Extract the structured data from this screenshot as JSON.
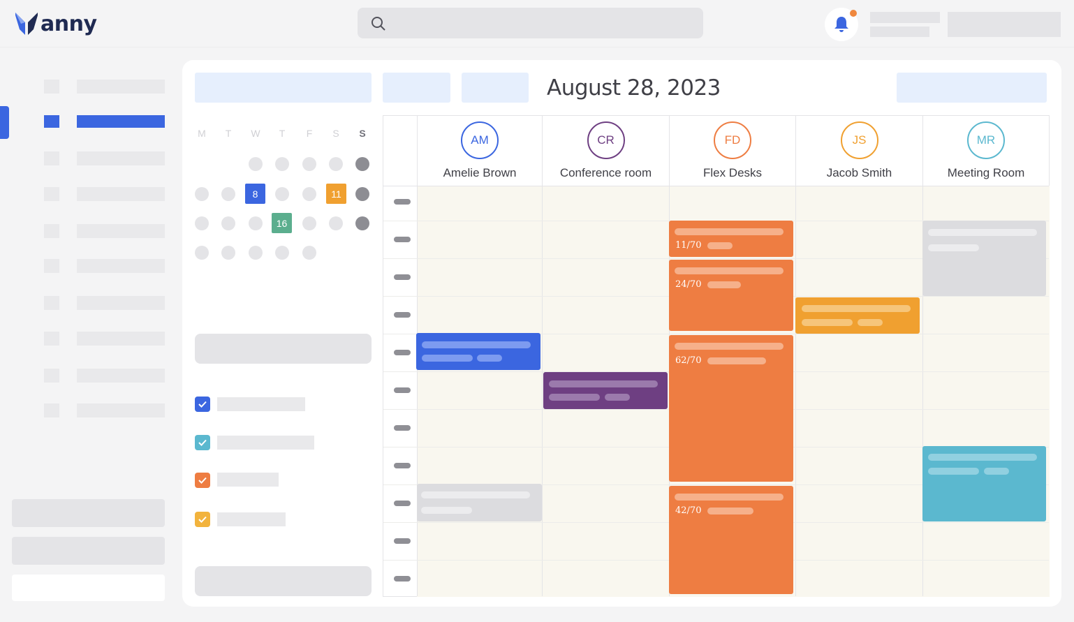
{
  "app": {
    "logo_text": "anny",
    "search_icon": "search-icon",
    "bell_icon": "bell-icon",
    "notification_dot_color": "#f0883e"
  },
  "calendar": {
    "title": "August 28, 2023",
    "weekdays": [
      "M",
      "T",
      "W",
      "T",
      "F",
      "S",
      "S"
    ],
    "highlighted_days": [
      {
        "day": "8",
        "color": "#3b66e0"
      },
      {
        "day": "11",
        "color": "#f0a030"
      },
      {
        "day": "16",
        "color": "#5bae8e"
      }
    ]
  },
  "filters": [
    {
      "color": "#3b66e0",
      "checked": true
    },
    {
      "color": "#5bb8cf",
      "checked": true
    },
    {
      "color": "#ee7d42",
      "checked": true
    },
    {
      "color": "#f2b33d",
      "checked": true
    }
  ],
  "resources": [
    {
      "initials": "AM",
      "name": "Amelie Brown",
      "color": "#3b66e0"
    },
    {
      "initials": "CR",
      "name": "Conference room",
      "color": "#6e3f82"
    },
    {
      "initials": "FD",
      "name": "Flex Desks",
      "color": "#ee7d42"
    },
    {
      "initials": "JS",
      "name": "Jacob Smith",
      "color": "#f0a030"
    },
    {
      "initials": "MR",
      "name": "Meeting Room",
      "color": "#5bb8cf"
    }
  ],
  "events": {
    "flex_1_capacity": "11/70",
    "flex_2_capacity": "24/70",
    "flex_3_capacity": "62/70",
    "flex_4_capacity": "42/70"
  },
  "colors": {
    "accent": "#3b66e0",
    "orange": "#ee7d42",
    "amber": "#f0a030",
    "purple": "#6e3f82",
    "teal": "#5bb8cf",
    "grey_event": "#dcdcdf",
    "grid_bg": "#f9f7ef"
  }
}
